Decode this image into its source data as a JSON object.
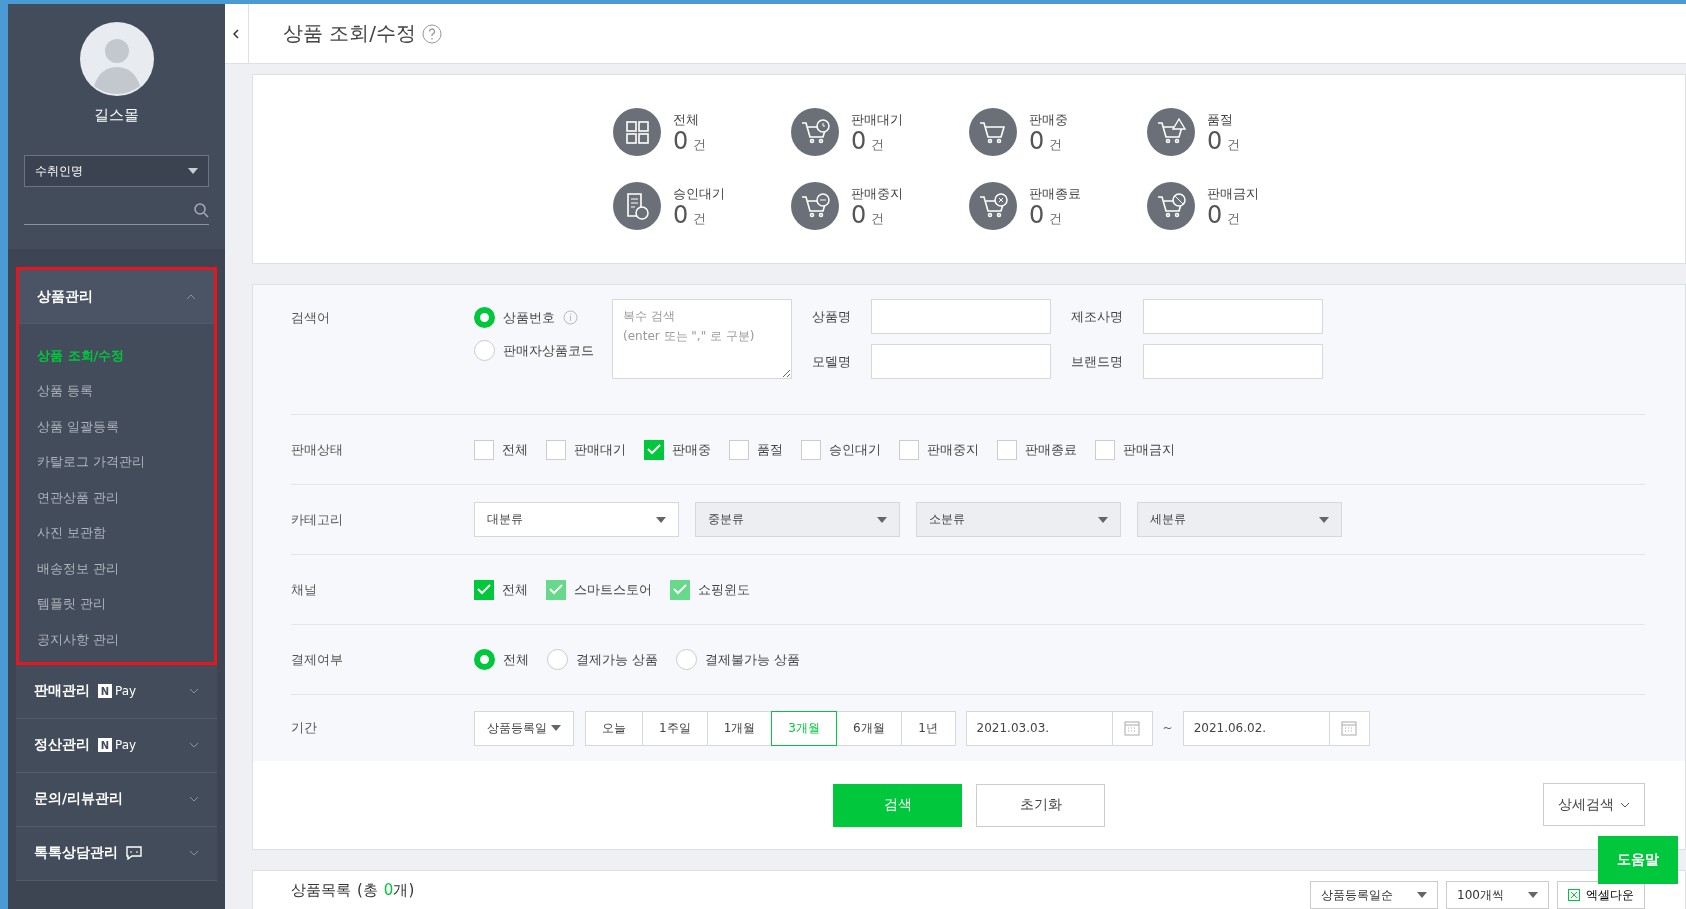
{
  "sidebar": {
    "profile_name": "길스몰",
    "search_select": "수취인명",
    "menu": [
      {
        "label": "상품관리",
        "expanded": true,
        "kind": "plain",
        "children": [
          {
            "label": "상품 조회/수정",
            "selected": true
          },
          {
            "label": "상품 등록",
            "selected": false
          },
          {
            "label": "상품 일괄등록",
            "selected": false
          },
          {
            "label": "카탈로그 가격관리",
            "selected": false
          },
          {
            "label": "연관상품 관리",
            "selected": false
          },
          {
            "label": "사진 보관함",
            "selected": false
          },
          {
            "label": "배송정보 관리",
            "selected": false
          },
          {
            "label": "템플릿 관리",
            "selected": false
          },
          {
            "label": "공지사항 관리",
            "selected": false
          }
        ]
      },
      {
        "label": "판매관리",
        "expanded": false,
        "kind": "npay",
        "badge_mark": "N",
        "badge_text": "Pay"
      },
      {
        "label": "정산관리",
        "expanded": false,
        "kind": "npay",
        "badge_mark": "N",
        "badge_text": "Pay"
      },
      {
        "label": "문의/리뷰관리",
        "expanded": false,
        "kind": "plain"
      },
      {
        "label": "톡톡상담관리",
        "expanded": false,
        "kind": "talk"
      }
    ]
  },
  "header": {
    "title": "상품 조회/수정"
  },
  "stats": [
    {
      "kind": "grid",
      "label": "전체",
      "count": "0",
      "unit": "건"
    },
    {
      "kind": "cart-clock",
      "label": "판매대기",
      "count": "0",
      "unit": "건"
    },
    {
      "kind": "cart",
      "label": "판매중",
      "count": "0",
      "unit": "건"
    },
    {
      "kind": "cart-alert",
      "label": "품절",
      "count": "0",
      "unit": "건"
    },
    {
      "kind": "doc-clock",
      "label": "승인대기",
      "count": "0",
      "unit": "건"
    },
    {
      "kind": "cart-minus",
      "label": "판매중지",
      "count": "0",
      "unit": "건"
    },
    {
      "kind": "cart-x",
      "label": "판매종료",
      "count": "0",
      "unit": "건"
    },
    {
      "kind": "cart-ban",
      "label": "판매금지",
      "count": "0",
      "unit": "건"
    }
  ],
  "search": {
    "label": "검색어",
    "options": [
      {
        "label": "상품번호",
        "selected": true
      },
      {
        "label": "판매자상품코드",
        "selected": false
      }
    ],
    "multi_placeholder": "복수 검색\n(enter 또는 \",\" 로 구분)",
    "fields": [
      {
        "label": "상품명"
      },
      {
        "label": "제조사명"
      },
      {
        "label": "모델명"
      },
      {
        "label": "브랜드명"
      }
    ]
  },
  "sale_status": {
    "label": "판매상태",
    "options": [
      {
        "label": "전체",
        "checked": false
      },
      {
        "label": "판매대기",
        "checked": false
      },
      {
        "label": "판매중",
        "checked": true
      },
      {
        "label": "품절",
        "checked": false
      },
      {
        "label": "승인대기",
        "checked": false
      },
      {
        "label": "판매중지",
        "checked": false
      },
      {
        "label": "판매종료",
        "checked": false
      },
      {
        "label": "판매금지",
        "checked": false
      }
    ]
  },
  "category": {
    "label": "카테고리",
    "selects": [
      {
        "value": "대분류",
        "disabled": false
      },
      {
        "value": "중분류",
        "disabled": true
      },
      {
        "value": "소분류",
        "disabled": true
      },
      {
        "value": "세분류",
        "disabled": true
      }
    ]
  },
  "channel": {
    "label": "채널",
    "options": [
      {
        "label": "전체",
        "checked": true,
        "disabled": false
      },
      {
        "label": "스마트스토어",
        "checked": true,
        "disabled": true
      },
      {
        "label": "쇼핑윈도",
        "checked": true,
        "disabled": true
      }
    ]
  },
  "payment": {
    "label": "결제여부",
    "options": [
      {
        "label": "전체",
        "selected": true
      },
      {
        "label": "결제가능 상품",
        "selected": false
      },
      {
        "label": "결제불가능 상품",
        "selected": false
      }
    ]
  },
  "period": {
    "label": "기간",
    "type_select": "상품등록일",
    "ranges": [
      {
        "label": "오늘",
        "selected": false
      },
      {
        "label": "1주일",
        "selected": false
      },
      {
        "label": "1개월",
        "selected": false
      },
      {
        "label": "3개월",
        "selected": true
      },
      {
        "label": "6개월",
        "selected": false
      },
      {
        "label": "1년",
        "selected": false
      }
    ],
    "start": "2021.03.03.",
    "separator": "~",
    "end": "2021.06.02."
  },
  "actions": {
    "search": "검색",
    "reset": "초기화",
    "detail": "상세검색"
  },
  "help": "도움말",
  "list": {
    "title": "상품목록",
    "total_prefix": "(총",
    "total": "0",
    "total_suffix": "개)",
    "sort": "상품등록일순",
    "page_size": "100개씩",
    "excel": "엑셀다운"
  }
}
